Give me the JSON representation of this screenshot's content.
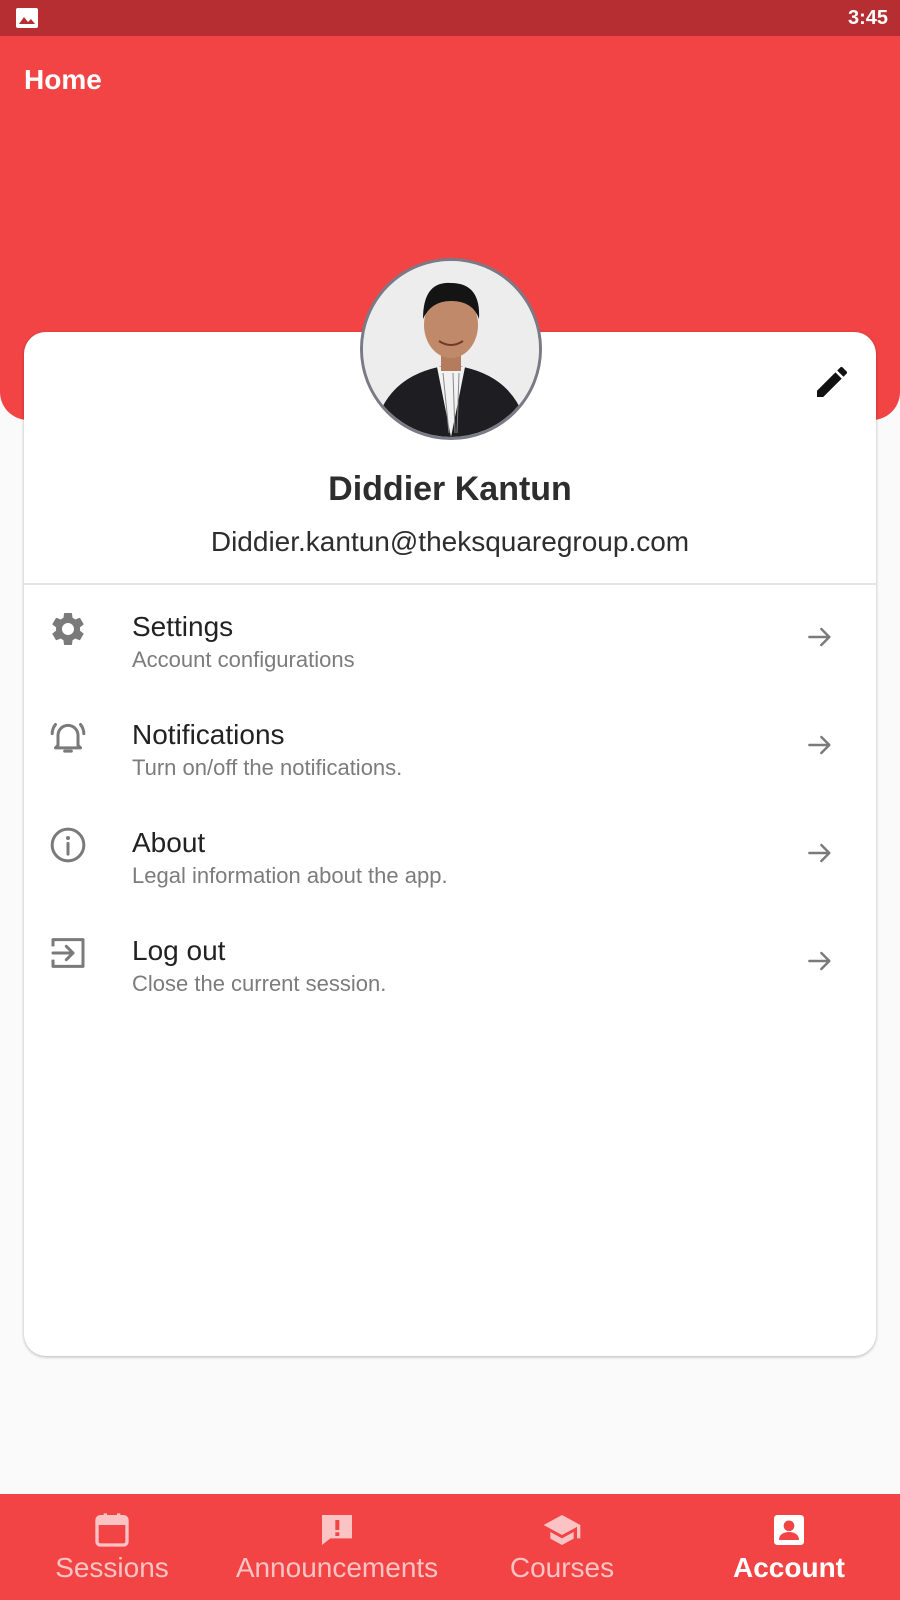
{
  "status_bar": {
    "time": "3:45",
    "left_icon": "image-icon"
  },
  "header": {
    "title": "Home"
  },
  "profile": {
    "name": "Diddier Kantun",
    "email": "Diddier.kantun@theksquaregroup.com",
    "edit_icon": "pencil-icon"
  },
  "menu": [
    {
      "title": "Settings",
      "subtitle": "Account configurations",
      "icon": "gear-icon"
    },
    {
      "title": "Notifications",
      "subtitle": "Turn on/off the notifications.",
      "icon": "bell-icon"
    },
    {
      "title": "About",
      "subtitle": "Legal information about the app.",
      "icon": "info-icon"
    },
    {
      "title": "Log out",
      "subtitle": "Close the current session.",
      "icon": "logout-icon"
    }
  ],
  "bottom_nav": [
    {
      "label": "Sessions",
      "icon": "calendar-icon",
      "active": false
    },
    {
      "label": "Announcements",
      "icon": "announcement-icon",
      "active": false
    },
    {
      "label": "Courses",
      "icon": "graduation-cap-icon",
      "active": false
    },
    {
      "label": "Account",
      "icon": "account-box-icon",
      "active": true
    }
  ],
  "colors": {
    "primary": "#f24444",
    "status_bar": "#b72e32",
    "background": "#fafafa",
    "nav_inactive": "#fbc3c3",
    "nav_active": "#ffffff"
  }
}
